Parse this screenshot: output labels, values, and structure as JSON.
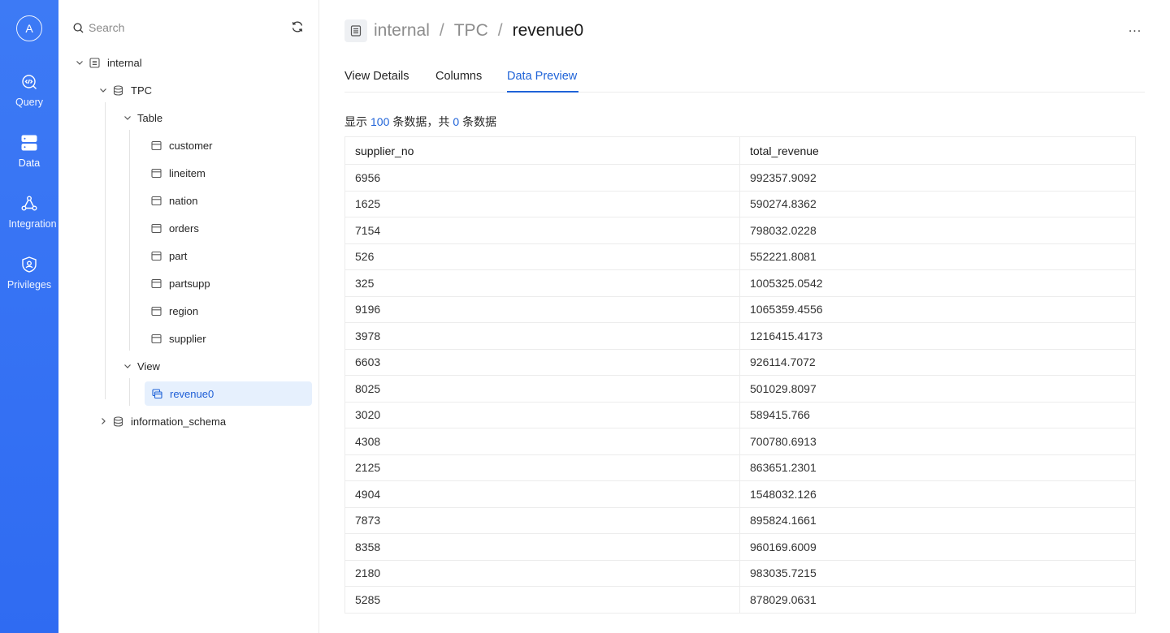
{
  "rail": {
    "avatar": "A",
    "items": [
      {
        "label": "Query",
        "icon": "query-icon"
      },
      {
        "label": "Data",
        "icon": "data-icon"
      },
      {
        "label": "Integration",
        "icon": "integration-icon"
      },
      {
        "label": "Privileges",
        "icon": "privileges-icon"
      }
    ],
    "active": "Data"
  },
  "tree": {
    "search_placeholder": "Search",
    "nodes": {
      "internal": "internal",
      "tpc": "TPC",
      "table_group": "Table",
      "tables": [
        "customer",
        "lineitem",
        "nation",
        "orders",
        "part",
        "partsupp",
        "region",
        "supplier"
      ],
      "view_group": "View",
      "views": [
        "revenue0"
      ],
      "information_schema": "information_schema"
    }
  },
  "main": {
    "breadcrumb": {
      "catalog": "internal",
      "schema": "TPC",
      "object": "revenue0",
      "separator": "/"
    },
    "more": "...",
    "tabs": [
      "View Details",
      "Columns",
      "Data Preview"
    ],
    "active_tab": "Data Preview",
    "summary": {
      "prefix": "显示",
      "shown": "100",
      "middle": "条数据，共",
      "total": "0",
      "suffix": "条数据"
    },
    "table": {
      "columns": [
        "supplier_no",
        "total_revenue"
      ],
      "rows": [
        [
          "6956",
          "992357.9092"
        ],
        [
          "1625",
          "590274.8362"
        ],
        [
          "7154",
          "798032.0228"
        ],
        [
          "526",
          "552221.8081"
        ],
        [
          "325",
          "1005325.0542"
        ],
        [
          "9196",
          "1065359.4556"
        ],
        [
          "3978",
          "1216415.4173"
        ],
        [
          "6603",
          "926114.7072"
        ],
        [
          "8025",
          "501029.8097"
        ],
        [
          "3020",
          "589415.766"
        ],
        [
          "4308",
          "700780.6913"
        ],
        [
          "2125",
          "863651.2301"
        ],
        [
          "4904",
          "1548032.126"
        ],
        [
          "7873",
          "895824.1661"
        ],
        [
          "8358",
          "960169.6009"
        ],
        [
          "2180",
          "983035.7215"
        ],
        [
          "5285",
          "878029.0631"
        ]
      ]
    }
  },
  "colors": {
    "rail": "#2f6bf2",
    "accent": "#1f63d8",
    "selected_bg": "#e6f0fd"
  }
}
